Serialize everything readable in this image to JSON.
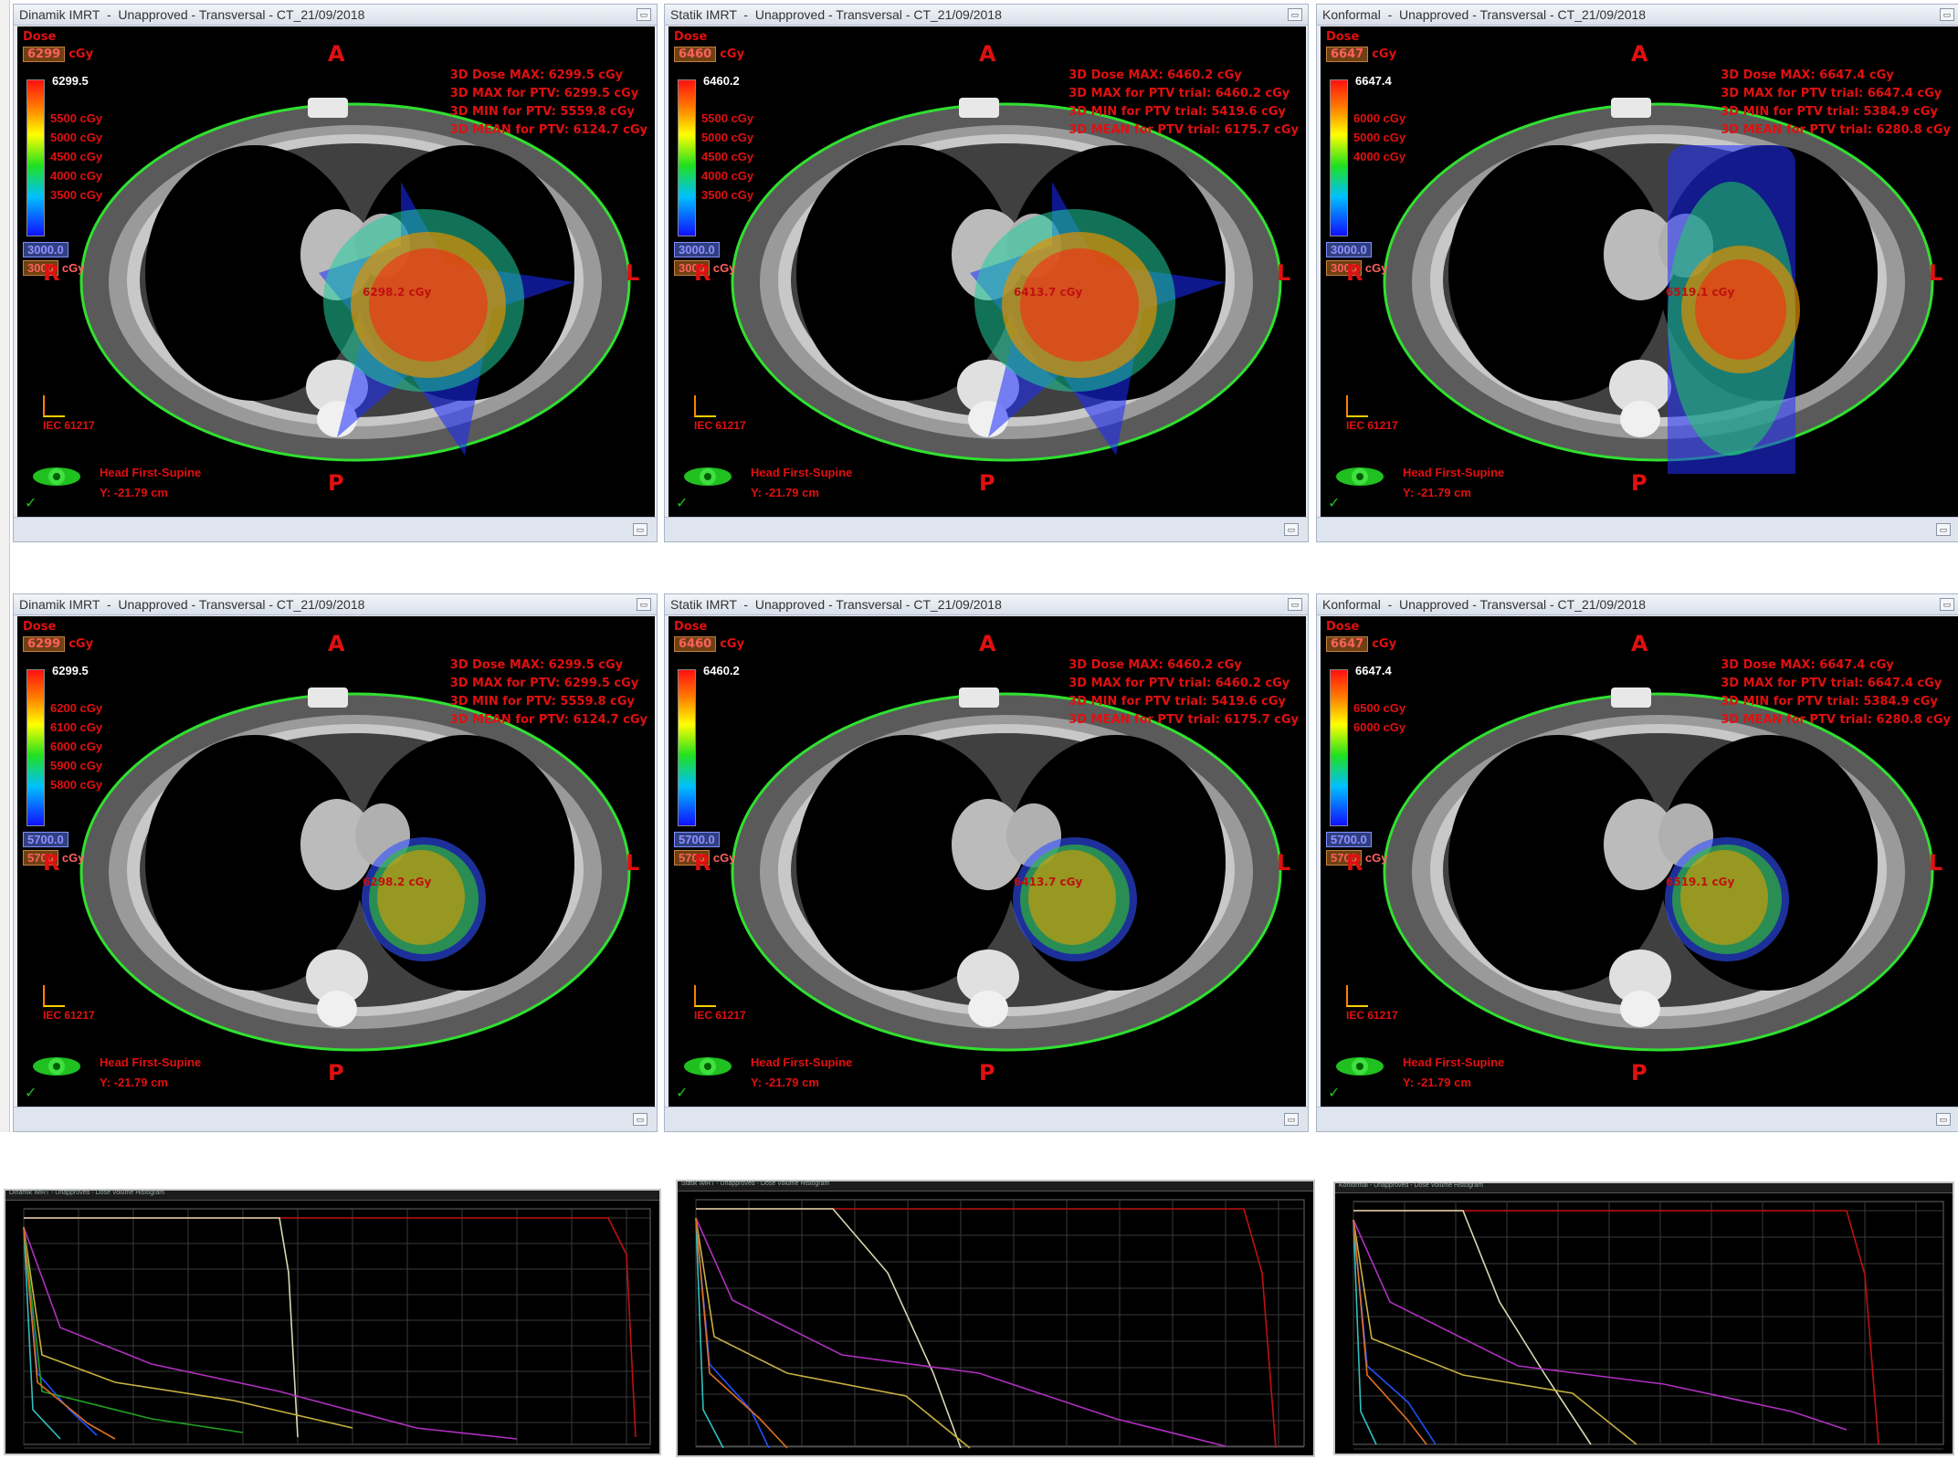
{
  "panels": [
    {
      "id": "p1",
      "title": "Dinamik IMRT  -  Unapproved - Transversal - CT_21/09/2018",
      "dose_label": "Dose",
      "dose_value": "6299",
      "dose_unit": "cGy",
      "legend_max": "6299.5",
      "legend_ticks": [
        "5500 cGy",
        "5000 cGy",
        "4500 cGy",
        "4000 cGy",
        "3500 cGy"
      ],
      "legend_min": "3000.0",
      "legend_min2_value": "3000",
      "legend_min2_unit": "cGy",
      "stats": [
        "3D Dose MAX: 6299.5 cGy",
        "3D MAX for PTV: 6299.5 cGy",
        "3D MIN for PTV: 5559.8 cGy",
        "3D MEAN for PTV: 6124.7 cGy"
      ],
      "point_label": "6298.2 cGy",
      "orient": {
        "top": "A",
        "bottom": "P",
        "left": "R",
        "right": "L"
      },
      "iec": "IEC 61217",
      "position": "Head First-Supine",
      "y": "Y: -21.79 cm"
    },
    {
      "id": "p2",
      "title": "Statik IMRT  -  Unapproved - Transversal - CT_21/09/2018",
      "dose_label": "Dose",
      "dose_value": "6460",
      "dose_unit": "cGy",
      "legend_max": "6460.2",
      "legend_ticks": [
        "5500 cGy",
        "5000 cGy",
        "4500 cGy",
        "4000 cGy",
        "3500 cGy"
      ],
      "legend_min": "3000.0",
      "legend_min2_value": "3000",
      "legend_min2_unit": "cGy",
      "stats": [
        "3D Dose MAX: 6460.2 cGy",
        "3D MAX for PTV trial: 6460.2 cGy",
        "3D MIN for PTV trial: 5419.6 cGy",
        "3D MEAN for PTV trial: 6175.7 cGy"
      ],
      "point_label": "6413.7 cGy",
      "orient": {
        "top": "A",
        "bottom": "P",
        "left": "R",
        "right": "L"
      },
      "iec": "IEC 61217",
      "position": "Head First-Supine",
      "y": "Y: -21.79 cm"
    },
    {
      "id": "p3",
      "title": "Konformal  -  Unapproved - Transversal - CT_21/09/2018",
      "dose_label": "Dose",
      "dose_value": "6647",
      "dose_unit": "cGy",
      "legend_max": "6647.4",
      "legend_ticks": [
        "6000 cGy",
        "5000 cGy",
        "4000 cGy"
      ],
      "legend_min": "3000.0",
      "legend_min2_value": "3000",
      "legend_min2_unit": "cGy",
      "stats": [
        "3D Dose MAX: 6647.4 cGy",
        "3D MAX for PTV trial: 6647.4 cGy",
        "3D MIN for PTV trial: 5384.9 cGy",
        "3D MEAN for PTV trial: 6280.8 cGy"
      ],
      "point_label": "6519.1 cGy",
      "orient": {
        "top": "A",
        "bottom": "P",
        "left": "R",
        "right": "L"
      },
      "iec": "IEC 61217",
      "position": "Head First-Supine",
      "y": "Y: -21.79 cm"
    },
    {
      "id": "p4",
      "title": "Dinamik IMRT  -  Unapproved - Transversal - CT_21/09/2018",
      "dose_label": "Dose",
      "dose_value": "6299",
      "dose_unit": "cGy",
      "legend_max": "6299.5",
      "legend_ticks": [
        "6200 cGy",
        "6100 cGy",
        "6000 cGy",
        "5900 cGy",
        "5800 cGy"
      ],
      "legend_min": "5700.0",
      "legend_min2_value": "5700",
      "legend_min2_unit": "cGy",
      "stats": [
        "3D Dose MAX: 6299.5 cGy",
        "3D MAX for PTV: 6299.5 cGy",
        "3D MIN for PTV: 5559.8 cGy",
        "3D MEAN for PTV: 6124.7 cGy"
      ],
      "point_label": "6298.2 cGy",
      "orient": {
        "top": "A",
        "bottom": "P",
        "left": "R",
        "right": "L"
      },
      "iec": "IEC 61217",
      "position": "Head First-Supine",
      "y": "Y: -21.79 cm"
    },
    {
      "id": "p5",
      "title": "Statik IMRT  -  Unapproved - Transversal - CT_21/09/2018",
      "dose_label": "Dose",
      "dose_value": "6460",
      "dose_unit": "cGy",
      "legend_max": "6460.2",
      "legend_ticks": [],
      "legend_min": "5700.0",
      "legend_min2_value": "5700",
      "legend_min2_unit": "cGy",
      "stats": [
        "3D Dose MAX: 6460.2 cGy",
        "3D MAX for PTV trial: 6460.2 cGy",
        "3D MIN for PTV trial: 5419.6 cGy",
        "3D MEAN for PTV trial: 6175.7 cGy"
      ],
      "point_label": "6413.7 cGy",
      "orient": {
        "top": "A",
        "bottom": "P",
        "left": "R",
        "right": "L"
      },
      "iec": "IEC 61217",
      "position": "Head First-Supine",
      "y": "Y: -21.79 cm"
    },
    {
      "id": "p6",
      "title": "Konformal  -  Unapproved - Transversal - CT_21/09/2018",
      "dose_label": "Dose",
      "dose_value": "6647",
      "dose_unit": "cGy",
      "legend_max": "6647.4",
      "legend_ticks": [
        "6500 cGy",
        "6000 cGy"
      ],
      "legend_min": "5700.0",
      "legend_min2_value": "5700",
      "legend_min2_unit": "cGy",
      "stats": [
        "3D Dose MAX: 6647.4 cGy",
        "3D MAX for PTV trial: 6647.4 cGy",
        "3D MIN for PTV trial: 5384.9 cGy",
        "3D MEAN for PTV trial: 6280.8 cGy"
      ],
      "point_label": "6519.1 cGy",
      "orient": {
        "top": "A",
        "bottom": "P",
        "left": "R",
        "right": "L"
      },
      "iec": "IEC 61217",
      "position": "Head First-Supine",
      "y": "Y: -21.79 cm"
    }
  ],
  "dvh": [
    {
      "title": "Dinamik IMRT - Unapproved - Dose Volume Histogram"
    },
    {
      "title": "Statik IMRT - Unapproved - Dose Volume Histogram"
    },
    {
      "title": "Konformal - Unapproved - Dose Volume Histogram"
    }
  ]
}
